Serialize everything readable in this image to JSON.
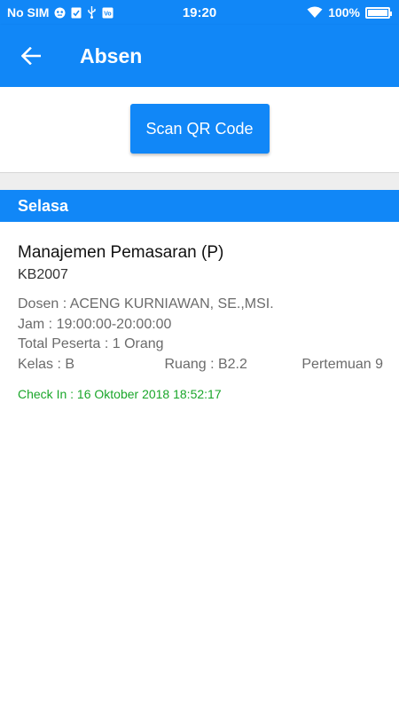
{
  "status_bar": {
    "carrier": "No SIM",
    "time": "19:20",
    "battery_percent": "100%",
    "battery_level": 1.0,
    "icons": [
      "ghost-icon",
      "check-icon",
      "usb-icon",
      "vpn-icon",
      "wifi-icon"
    ]
  },
  "app_bar": {
    "title": "Absen",
    "back_icon": "arrow-left-icon"
  },
  "scan": {
    "button_label": "Scan QR Code"
  },
  "section": {
    "day": "Selasa"
  },
  "course": {
    "name": "Manajemen Pemasaran (P)",
    "code": "KB2007",
    "dosen": "Dosen : ACENG KURNIAWAN, SE.,MSI.",
    "jam": "Jam : 19:00:00-20:00:00",
    "peserta": "Total Peserta : 1 Orang",
    "kelas": "Kelas : B",
    "ruang": "Ruang : B2.2",
    "pertemuan": "Pertemuan 9",
    "checkin": "Check In : 16 Oktober 2018 18:52:17"
  },
  "colors": {
    "primary": "#1187f7",
    "checkin_green": "#1aa62a",
    "detail_gray": "#6b6b6b",
    "band_gray": "#eeeeee"
  }
}
